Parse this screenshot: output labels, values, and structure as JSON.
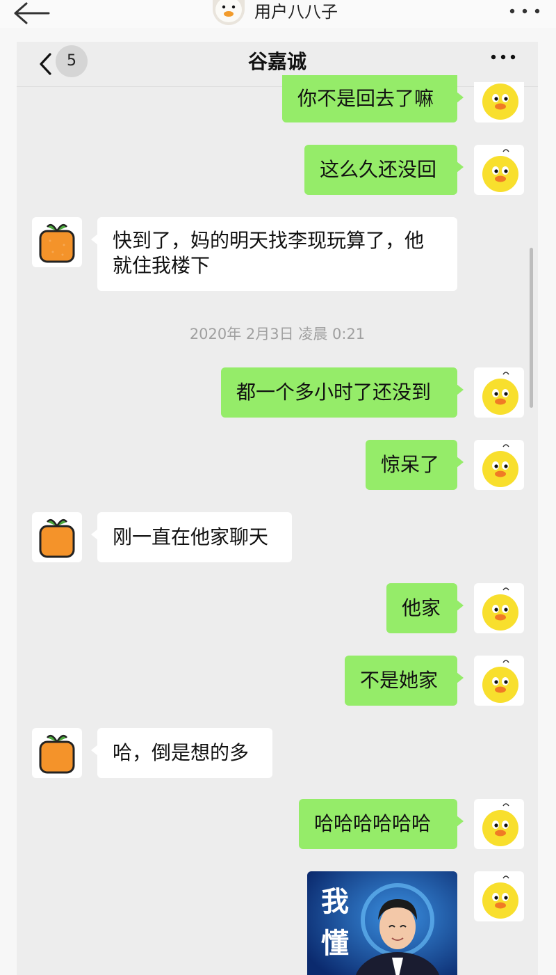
{
  "outer_header": {
    "title": "用户八八子",
    "more_icon": "more-dots-icon",
    "back_icon": "back-arrow-icon"
  },
  "chat": {
    "title": "谷嘉诚",
    "unread_count": "5",
    "more_icon": "more-dots-icon",
    "timestamp": "2020年 2月3日 凌晨 0:21",
    "messages": [
      {
        "side": "out",
        "text": "你不是回去了嘛"
      },
      {
        "side": "out",
        "text": "这么久还没回"
      },
      {
        "side": "in",
        "text_line1": "快到了，妈的明天找李现玩算了，他",
        "text_line2": "就住我楼下"
      },
      {
        "side": "out",
        "text": "都一个多小时了还没到"
      },
      {
        "side": "out",
        "text": "惊呆了"
      },
      {
        "side": "in",
        "text": "刚一直在他家聊天"
      },
      {
        "side": "out",
        "text": "他家"
      },
      {
        "side": "out",
        "text": "不是她家"
      },
      {
        "side": "in",
        "text": "哈，倒是想的多"
      },
      {
        "side": "out",
        "text": "哈哈哈哈哈哈"
      }
    ],
    "sticker": {
      "caption_char_1": "我",
      "caption_char_2": "懂"
    }
  },
  "colors": {
    "outgoing_bubble": "#95ec69",
    "incoming_bubble": "#ffffff",
    "chat_background": "#ededed"
  }
}
